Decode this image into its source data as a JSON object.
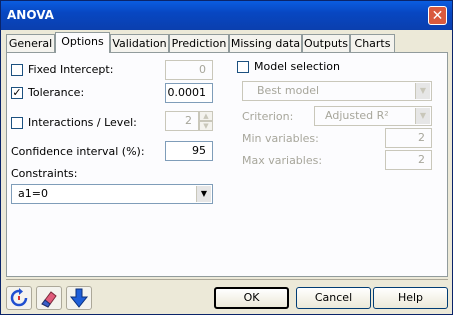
{
  "window": {
    "title": "ANOVA",
    "close_glyph": "✕"
  },
  "tabs": [
    {
      "label": "General",
      "active": false
    },
    {
      "label": "Options",
      "active": true
    },
    {
      "label": "Validation",
      "active": false
    },
    {
      "label": "Prediction",
      "active": false
    },
    {
      "label": "Missing data",
      "active": false
    },
    {
      "label": "Outputs",
      "active": false
    },
    {
      "label": "Charts",
      "active": false
    }
  ],
  "options": {
    "fixed_intercept": {
      "label": "Fixed Intercept:",
      "checked": false,
      "value": "0"
    },
    "tolerance": {
      "label": "Tolerance:",
      "checked": true,
      "check_glyph": "✓",
      "value": "0.0001"
    },
    "interactions": {
      "label": "Interactions / Level:",
      "checked": false,
      "value": "2"
    },
    "confidence": {
      "label": "Confidence interval (%):",
      "value": "95"
    },
    "constraints": {
      "label": "Constraints:",
      "value": "a1=0"
    },
    "model_selection": {
      "label": "Model selection",
      "checked": false,
      "method": "Best model",
      "criterion_label": "Criterion:",
      "criterion_value": "Adjusted R²",
      "min_label": "Min variables:",
      "min_value": "2",
      "max_label": "Max variables:",
      "max_value": "2"
    }
  },
  "footer": {
    "ok": "OK",
    "cancel": "Cancel",
    "help": "Help"
  },
  "icons": [
    "reset-icon",
    "eraser-icon",
    "down-arrow-icon"
  ]
}
